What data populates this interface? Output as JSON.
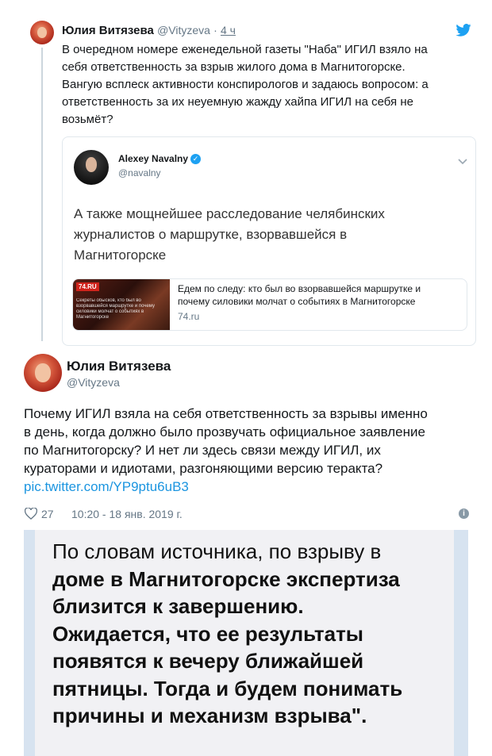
{
  "tweet_top": {
    "author_name": "Юлия Витязева",
    "author_handle": "@Vityzeva",
    "separator": "·",
    "time": "4 ч",
    "text_lines": [
      "В очередном номере еженедельной газеты \"Наба\" ИГИЛ взяло на",
      "себя ответственность за взрыв жилого дома в Магнитогорске.",
      "Вангую всплеск активности конспирологов и  задаюсь вопросом: а",
      "ответственность за их неуемную жажду хайпа ИГИЛ на себя не",
      "возьмёт?"
    ]
  },
  "quoted_tweet": {
    "author_name": "Alexey Navalny",
    "author_handle": "@navalny",
    "text_lines": [
      "А также мощнейшее расследование челябинских",
      "журналистов о маршрутке, взорвавшейся в",
      "Магнитогорске"
    ],
    "link_card": {
      "thumb_badge": "74.RU",
      "thumb_text": "Секреты обысков, кто был во взорвавшейся маршрутке и почему силовики молчат о событиях в Магнитогорске",
      "title_lines": [
        "Едем по следу: кто был во взорвавшейся маршрутке и",
        "почему силовики молчат о событиях в Магнитогорске"
      ],
      "domain": "74.ru"
    }
  },
  "tweet_main": {
    "author_name": "Юлия Витязева",
    "author_handle": "@Vityzeva",
    "text_lines": [
      "Почему ИГИЛ взяла на себя ответственность за взрывы именно",
      "в день, когда должно было прозвучать официальное заявление",
      "по Магнитогорску? И нет ли здесь связи между ИГИЛ, их",
      "кураторами и идиотами, разгоняющими версию теракта?"
    ],
    "link": "pic.twitter.com/YP9ptu6uB3",
    "likes": "27",
    "timestamp": "10:20 - 18 янв. 2019 г.",
    "info_icon": "i"
  },
  "quote_image": {
    "lines": [
      "По словам источника, по взрыву в",
      "доме в Магнитогорске экспертиза",
      "близится к завершению.",
      "Ожидается, что ее результаты",
      "появятся к вечеру ближайшей",
      "пятницы. Тогда и будем понимать",
      "причины и механизм взрыва\"."
    ]
  },
  "colors": {
    "twitter_blue": "#1da1f2",
    "link": "#1b95e0",
    "muted": "#657786",
    "border": "#e1e8ed"
  },
  "icons": [
    "twitter-bird-icon",
    "verified-badge-icon",
    "chevron-down-icon",
    "heart-icon",
    "info-icon"
  ]
}
